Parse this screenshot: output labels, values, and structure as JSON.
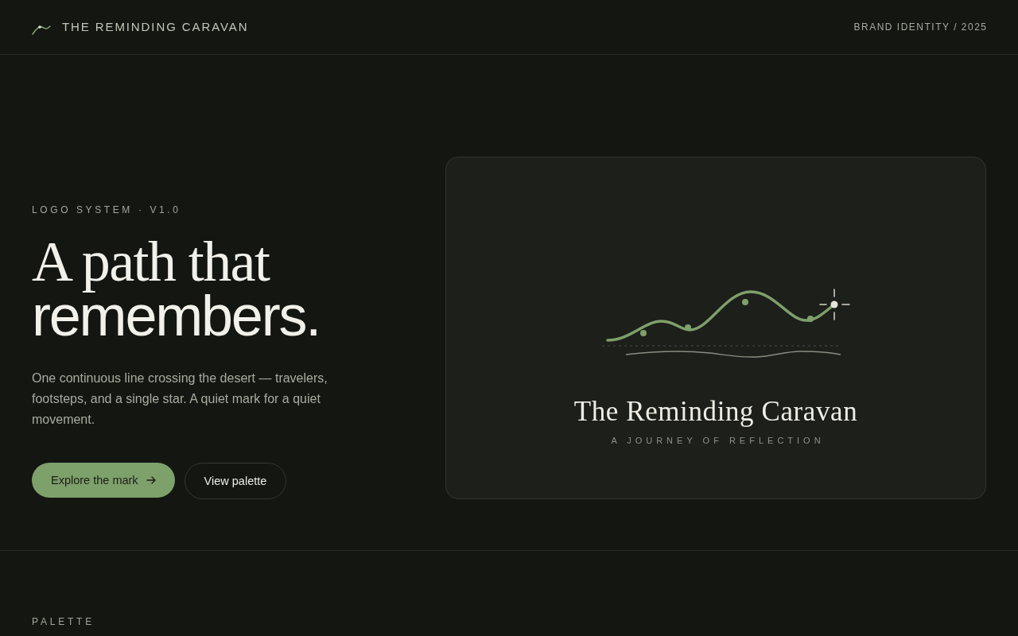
{
  "header": {
    "brand": "THE REMINDING CARAVAN",
    "meta": "BRAND IDENTITY / 2025"
  },
  "hero": {
    "eyebrow": "LOGO SYSTEM · V1.0",
    "headline_lines": [
      "A path that",
      "remembers."
    ],
    "description": "One continuous line crossing the desert — travelers, footsteps, and a single star. A quiet mark for a quiet movement.",
    "buttons": [
      {
        "label": "Explore the mark",
        "kind": "primary"
      },
      {
        "label": "View palette",
        "kind": "secondary"
      }
    ]
  },
  "logo_card": {
    "wordmark": "The Reminding Caravan",
    "tagline": "A JOURNEY OF REFLECTION"
  },
  "palette": {
    "heading": "PALETTE"
  }
}
